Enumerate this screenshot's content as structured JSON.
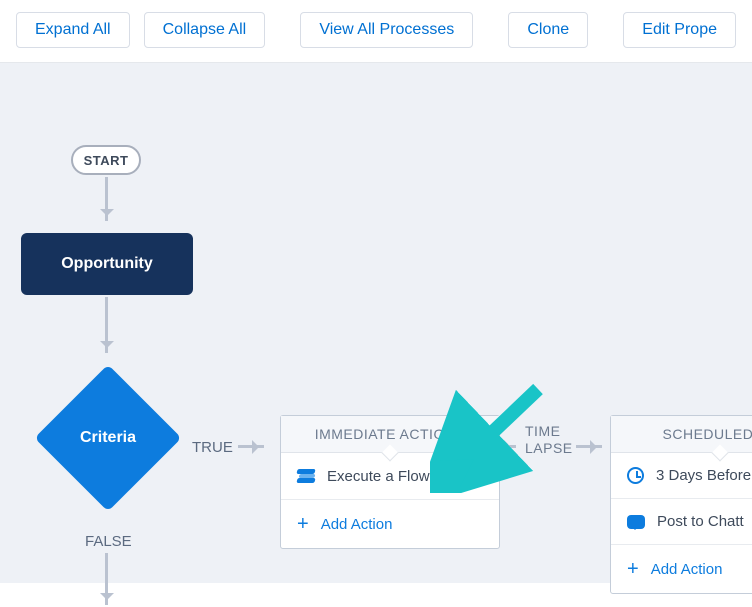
{
  "toolbar": {
    "expand_all": "Expand All",
    "collapse_all": "Collapse All",
    "view_all_processes": "View All Processes",
    "clone": "Clone",
    "edit_properties": "Edit Prope"
  },
  "flow": {
    "start_label": "START",
    "object_label": "Opportunity",
    "criteria_label": "Criteria",
    "true_label": "TRUE",
    "false_label": "FALSE",
    "timelapse_label_line1": "TIME",
    "timelapse_label_line2": "LAPSE"
  },
  "panels": {
    "immediate": {
      "header": "IMMEDIATE ACTIONS",
      "items": [
        {
          "icon": "flow-icon",
          "label": "Execute a Flow"
        }
      ],
      "add_label": "Add Action"
    },
    "scheduled": {
      "header": "SCHEDULED AC",
      "items": [
        {
          "icon": "clock-icon",
          "label": "3 Days Before"
        },
        {
          "icon": "chat-icon",
          "label": "Post to Chatt"
        }
      ],
      "add_label": "Add Action"
    }
  }
}
